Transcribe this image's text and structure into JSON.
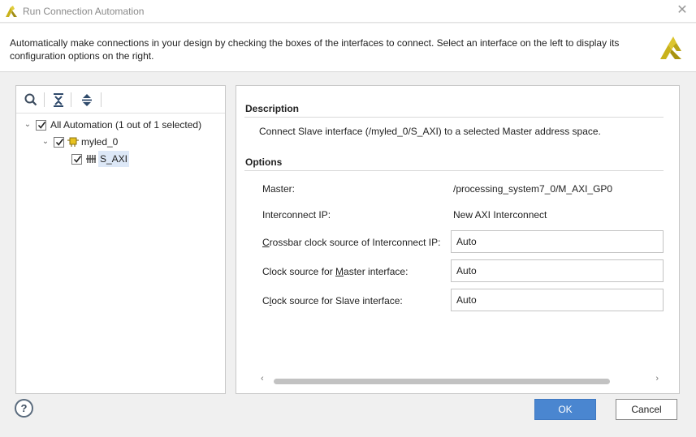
{
  "window": {
    "title": "Run Connection Automation",
    "close_glyph": "✕"
  },
  "banner": {
    "text": "Automatically make connections in your design by checking the boxes of the interfaces to connect. Select an interface on the left to display its configuration options on the right."
  },
  "toolbar": {
    "icons": [
      "search-icon",
      "collapse-all-icon",
      "expand-all-icon"
    ]
  },
  "tree": {
    "root": {
      "label": "All Automation (1 out of 1 selected)",
      "checked": true,
      "expanded": true
    },
    "ip": {
      "label": "myled_0",
      "checked": true,
      "expanded": true,
      "icon": "ip-core-icon"
    },
    "iface": {
      "label": "S_AXI",
      "checked": true,
      "selected": true,
      "icon": "bus-interface-icon"
    }
  },
  "details": {
    "description_title": "Description",
    "description": "Connect Slave interface (/myled_0/S_AXI) to a selected Master address space.",
    "options_title": "Options",
    "options": {
      "master_label": "Master:",
      "master_value": "/processing_system7_0/M_AXI_GP0",
      "interconnect_label": "Interconnect IP:",
      "interconnect_value": "New AXI Interconnect",
      "crossbar_label_pre": "",
      "crossbar_label_mnemonic": "C",
      "crossbar_label_post": "rossbar clock source of Interconnect IP:",
      "crossbar_value": "Auto",
      "master_clk_label_pre": "Clock source for ",
      "master_clk_label_mnemonic": "M",
      "master_clk_label_post": "aster interface:",
      "master_clk_value": "Auto",
      "slave_clk_label_pre": "C",
      "slave_clk_label_mnemonic": "l",
      "slave_clk_label_post": "ock source for Slave interface:",
      "slave_clk_value": "Auto"
    },
    "scroll_left": "‹",
    "scroll_right": "›"
  },
  "footer": {
    "help_label": "?",
    "ok_label": "OK",
    "cancel_label": "Cancel"
  },
  "colors": {
    "accent": "#4a86d0",
    "selection": "#dde8f7",
    "brand": "#c9b21b"
  }
}
